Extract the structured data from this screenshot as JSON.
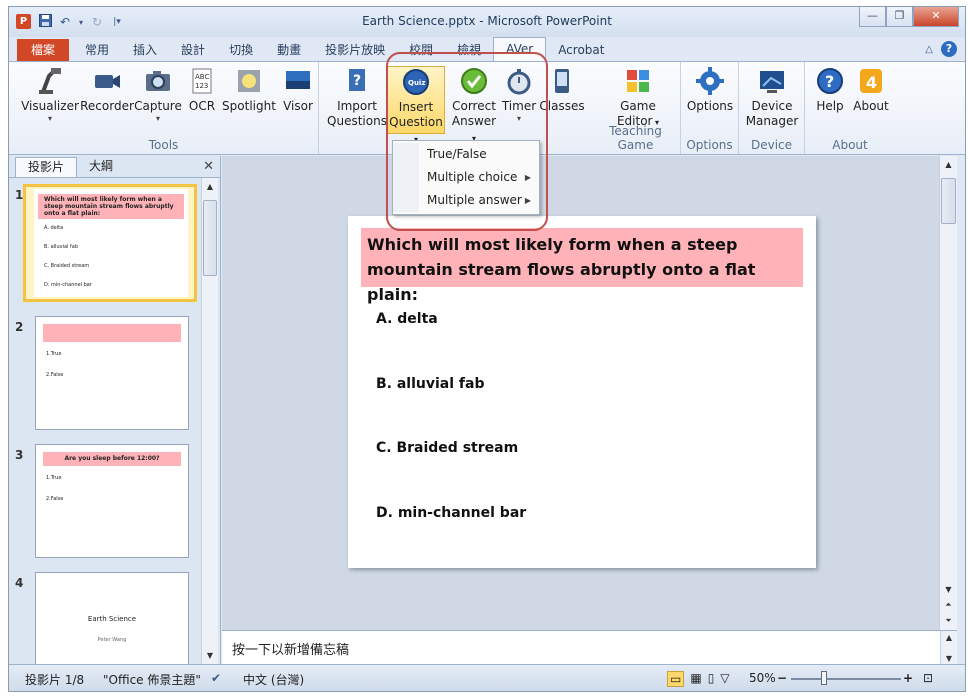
{
  "window": {
    "title": "Earth Science.pptx - Microsoft PowerPoint",
    "app_icon_letter": "P",
    "minimize": "—",
    "restore": "❐",
    "close": "✕"
  },
  "qat": {
    "save_icon": "save-icon",
    "undo_icon": "undo-icon",
    "redo_icon": "redo-icon",
    "customize_icon": "customize-qat-icon"
  },
  "tabs": [
    {
      "label": "檔案"
    },
    {
      "label": "常用"
    },
    {
      "label": "插入"
    },
    {
      "label": "設計"
    },
    {
      "label": "切換"
    },
    {
      "label": "動畫"
    },
    {
      "label": "投影片放映"
    },
    {
      "label": "校閱"
    },
    {
      "label": "檢視"
    },
    {
      "label": "AVer"
    },
    {
      "label": "Acrobat"
    }
  ],
  "ribbon": {
    "groups": {
      "tools": "Tools",
      "teaching_game": "Teaching Game",
      "options": "Options",
      "device": "Device",
      "about": "About"
    },
    "buttons": {
      "visualizer": "Visualizer",
      "recorder": "Recorder",
      "capture": "Capture",
      "ocr": "OCR",
      "spotlight": "Spotlight",
      "visor": "Visor",
      "import_1": "Import",
      "import_2": "Questions",
      "insert_1": "Insert",
      "insert_2": "Question",
      "correct_1": "Correct",
      "correct_2": "Answer",
      "timer": "Timer",
      "classes": "Classes",
      "game_1": "Game",
      "game_2": "Editor",
      "options": "Options",
      "device_1": "Device",
      "device_2": "Manager",
      "help": "Help",
      "about": "About"
    },
    "accent_color": "#fcd868"
  },
  "dropdown": {
    "items": [
      {
        "label": "True/False"
      },
      {
        "label": "Multiple choice"
      },
      {
        "label": "Multiple answer"
      }
    ]
  },
  "panel": {
    "tab_slides": "投影片",
    "tab_outline": "大綱",
    "close": "✕",
    "slides": [
      {
        "num": "1",
        "header": "Which will most likely form when a steep mountain stream flows abruptly onto a flat plain:",
        "items": [
          "A. delta",
          "B. alluvial fab",
          "C. Braided stream",
          "D. min-channel bar"
        ]
      },
      {
        "num": "2",
        "header": "",
        "items": [
          "1.True",
          "2.False"
        ]
      },
      {
        "num": "3",
        "header": "Are you sleep before 12:00?",
        "items": [
          "1.True",
          "2.False"
        ]
      },
      {
        "num": "4",
        "title": "Earth Science",
        "subtitle": "Peter Wang"
      }
    ]
  },
  "slide": {
    "question": "Which will most likely form when a steep mountain stream flows abruptly onto a flat plain:",
    "options": [
      "A. delta",
      "B. alluvial fab",
      "C. Braided stream",
      "D. min-channel bar"
    ]
  },
  "notes": {
    "placeholder": "按一下以新增備忘稿"
  },
  "status": {
    "slide_count": "投影片 1/8",
    "theme": "\"Office 佈景主題\"",
    "language": "中文 (台灣)",
    "zoom": "50%",
    "zoom_out": "−",
    "zoom_in": "+"
  }
}
